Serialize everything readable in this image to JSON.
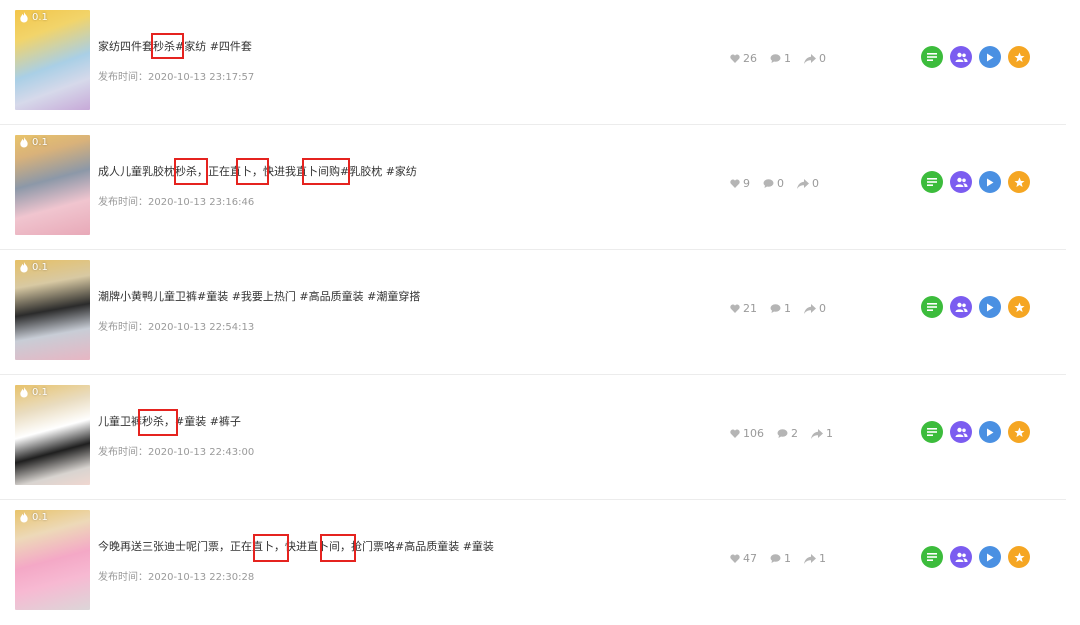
{
  "items": [
    {
      "hot": "0.1",
      "title": "家纺四件套秒杀#家纺 #四件套",
      "time": "发布时间：2020-10-13 23:17:57",
      "likes": "26",
      "comments": "1",
      "shares": "0"
    },
    {
      "hot": "0.1",
      "title": "成人儿童乳胶枕秒杀，正在直卜，快进我直卜间购#乳胶枕 #家纺",
      "time": "发布时间：2020-10-13 23:16:46",
      "likes": "9",
      "comments": "0",
      "shares": "0"
    },
    {
      "hot": "0.1",
      "title": "潮牌小黄鸭儿童卫裤#童装 #我要上热门 #高品质童装 #潮童穿搭",
      "time": "发布时间：2020-10-13 22:54:13",
      "likes": "21",
      "comments": "1",
      "shares": "0"
    },
    {
      "hot": "0.1",
      "title": "儿童卫裤秒杀，#童装 #裤子",
      "time": "发布时间：2020-10-13 22:43:00",
      "likes": "106",
      "comments": "2",
      "shares": "1"
    },
    {
      "hot": "0.1",
      "title": "今晚再送三张迪士呢门票，正在直卜，快进直卜间，抢门票咯#高品质童装 #童装",
      "time": "发布时间：2020-10-13 22:30:28",
      "likes": "47",
      "comments": "1",
      "shares": "1"
    }
  ],
  "actions": [
    {
      "name": "detail",
      "icon": "list-icon",
      "color": "#3cbc3c"
    },
    {
      "name": "fans",
      "icon": "users-icon",
      "color": "#7b5cf0"
    },
    {
      "name": "play",
      "icon": "play-icon",
      "color": "#4a90e2"
    },
    {
      "name": "favorite",
      "icon": "star-icon",
      "color": "#f5a623"
    }
  ],
  "highlight_color": "#e5231f"
}
